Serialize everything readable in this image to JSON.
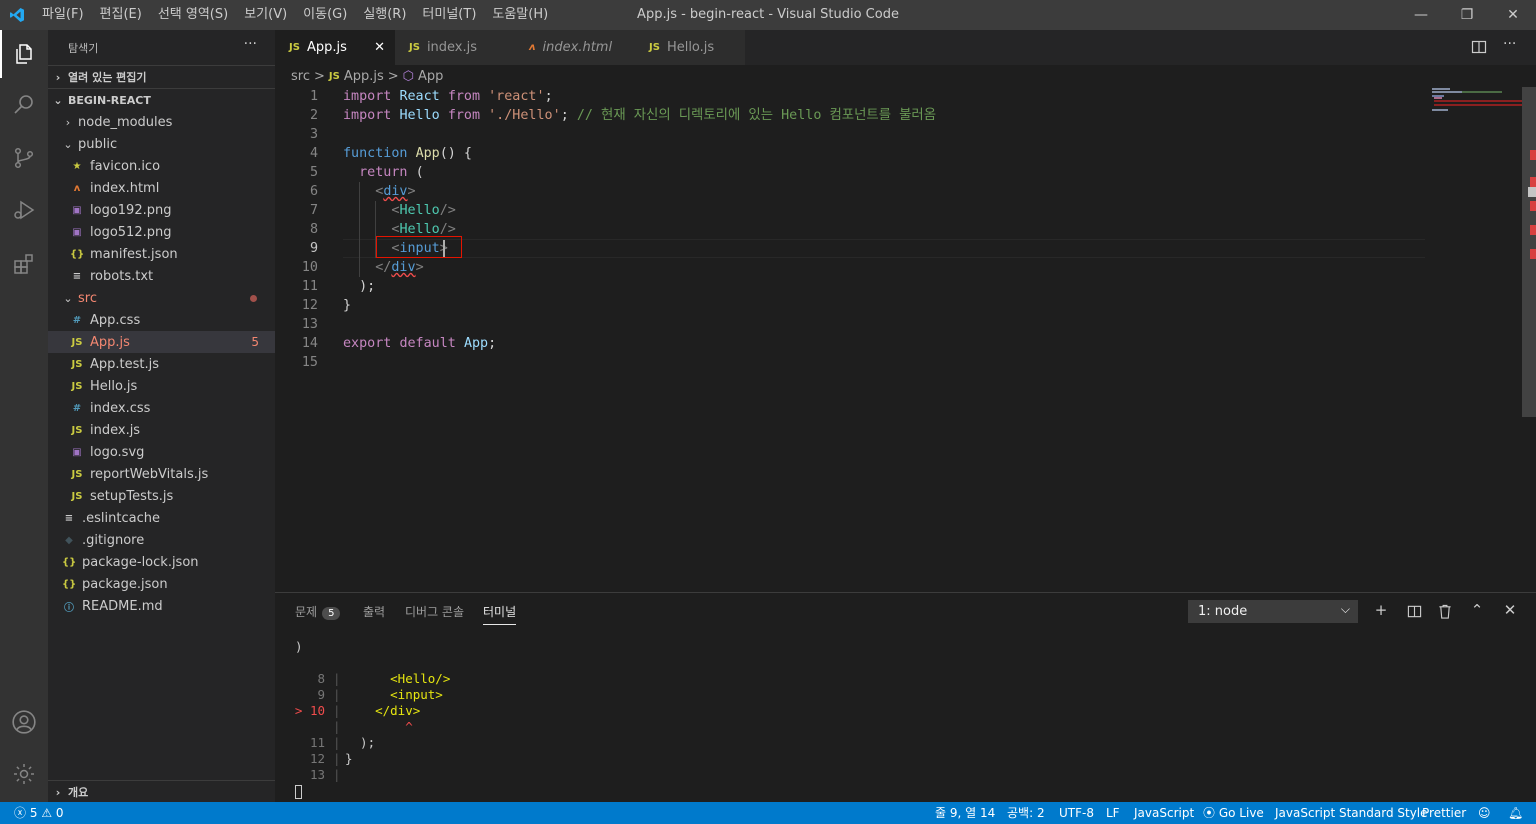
{
  "window": {
    "title": "App.js - begin-react - Visual Studio Code",
    "menu": [
      "파일(F)",
      "편집(E)",
      "선택 영역(S)",
      "보기(V)",
      "이동(G)",
      "실행(R)",
      "터미널(T)",
      "도움말(H)"
    ],
    "controls": {
      "minimize": "—",
      "restore": "❐",
      "close": "✕"
    }
  },
  "activity": [
    "explorer-icon",
    "search-icon",
    "source-control-icon",
    "run-debug-icon",
    "extensions-icon",
    "account-icon",
    "settings-gear-icon"
  ],
  "sidebar": {
    "title": "탐색기",
    "more": "···",
    "open_editors": "열려 있는 편집기",
    "project": "BEGIN-REACT",
    "outline": "개요",
    "tree": [
      {
        "label": "node_modules",
        "type": "folder",
        "expanded": false,
        "indent": 1
      },
      {
        "label": "public",
        "type": "folder",
        "expanded": true,
        "indent": 1
      },
      {
        "label": "favicon.ico",
        "type": "file",
        "icon": "★",
        "color": "#cbcb41",
        "indent": 2
      },
      {
        "label": "index.html",
        "type": "file",
        "icon": "ʌ",
        "color": "#e37933",
        "indent": 2
      },
      {
        "label": "logo192.png",
        "type": "file",
        "icon": "▣",
        "color": "#a074c4",
        "indent": 2
      },
      {
        "label": "logo512.png",
        "type": "file",
        "icon": "▣",
        "color": "#a074c4",
        "indent": 2
      },
      {
        "label": "manifest.json",
        "type": "file",
        "icon": "{}",
        "color": "#cbcb41",
        "indent": 2
      },
      {
        "label": "robots.txt",
        "type": "file",
        "icon": "≡",
        "color": "#cccccc",
        "indent": 2
      },
      {
        "label": "src",
        "type": "folder",
        "expanded": true,
        "indent": 1,
        "color": "#f48771",
        "dot": true
      },
      {
        "label": "App.css",
        "type": "file",
        "icon": "#",
        "color": "#519aba",
        "indent": 2
      },
      {
        "label": "App.js",
        "type": "file",
        "icon": "JS",
        "color": "#cbcb41",
        "indent": 2,
        "selected": true,
        "error": true,
        "count": "5"
      },
      {
        "label": "App.test.js",
        "type": "file",
        "icon": "JS",
        "color": "#cbcb41",
        "indent": 2
      },
      {
        "label": "Hello.js",
        "type": "file",
        "icon": "JS",
        "color": "#cbcb41",
        "indent": 2
      },
      {
        "label": "index.css",
        "type": "file",
        "icon": "#",
        "color": "#519aba",
        "indent": 2
      },
      {
        "label": "index.js",
        "type": "file",
        "icon": "JS",
        "color": "#cbcb41",
        "indent": 2
      },
      {
        "label": "logo.svg",
        "type": "file",
        "icon": "▣",
        "color": "#a074c4",
        "indent": 2
      },
      {
        "label": "reportWebVitals.js",
        "type": "file",
        "icon": "JS",
        "color": "#cbcb41",
        "indent": 2
      },
      {
        "label": "setupTests.js",
        "type": "file",
        "icon": "JS",
        "color": "#cbcb41",
        "indent": 2
      },
      {
        "label": ".eslintcache",
        "type": "file",
        "icon": "≡",
        "color": "#cccccc",
        "indent": 1
      },
      {
        "label": ".gitignore",
        "type": "file",
        "icon": "◆",
        "color": "#41535b",
        "indent": 1
      },
      {
        "label": "package-lock.json",
        "type": "file",
        "icon": "{}",
        "color": "#cbcb41",
        "indent": 1
      },
      {
        "label": "package.json",
        "type": "file",
        "icon": "{}",
        "color": "#cbcb41",
        "indent": 1
      },
      {
        "label": "README.md",
        "type": "file",
        "icon": "ⓘ",
        "color": "#519aba",
        "indent": 1
      }
    ]
  },
  "tabs": [
    {
      "label": "App.js",
      "icon": "JS",
      "active": true,
      "close": "✕"
    },
    {
      "label": "index.js",
      "icon": "JS",
      "active": false
    },
    {
      "label": "index.html",
      "icon": "ʌ",
      "active": false,
      "italic": true
    },
    {
      "label": "Hello.js",
      "icon": "JS",
      "active": false
    }
  ],
  "breadcrumb": [
    "src",
    ">",
    "JS",
    "App.js",
    ">",
    "⬡",
    "App"
  ],
  "editor": {
    "current_line": 9,
    "lines": [
      [
        [
          "kw2",
          "import "
        ],
        [
          "var",
          "React "
        ],
        [
          "kw2",
          "from "
        ],
        [
          "str",
          "'react'"
        ],
        [
          "plain",
          ";"
        ]
      ],
      [
        [
          "kw2",
          "import "
        ],
        [
          "var",
          "Hello "
        ],
        [
          "kw2",
          "from "
        ],
        [
          "str",
          "'./Hello'"
        ],
        [
          "plain",
          "; "
        ],
        [
          "cmt",
          "// 현재 자신의 디렉토리에 있는 Hello 컴포넌트를 불러옴"
        ]
      ],
      [],
      [
        [
          "kw",
          "function "
        ],
        [
          "fn",
          "App"
        ],
        [
          "plain",
          "() {"
        ]
      ],
      [
        [
          "plain",
          "  "
        ],
        [
          "kw2",
          "return "
        ],
        [
          "plain",
          "("
        ]
      ],
      [
        [
          "plain",
          "    "
        ],
        [
          "punc",
          "<"
        ],
        [
          "tag",
          "div"
        ],
        [
          "punc",
          ">"
        ]
      ],
      [
        [
          "plain",
          "      "
        ],
        [
          "punc",
          "<"
        ],
        [
          "cls",
          "Hello"
        ],
        [
          "punc",
          "/>"
        ]
      ],
      [
        [
          "plain",
          "      "
        ],
        [
          "punc",
          "<"
        ],
        [
          "cls",
          "Hello"
        ],
        [
          "punc",
          "/>"
        ]
      ],
      [
        [
          "plain",
          "      "
        ],
        [
          "punc",
          "<"
        ],
        [
          "tag",
          "input"
        ],
        [
          "punc",
          ">"
        ]
      ],
      [
        [
          "plain",
          "    "
        ],
        [
          "punc",
          "</"
        ],
        [
          "tag",
          "div"
        ],
        [
          "punc",
          ">"
        ]
      ],
      [
        [
          "plain",
          "  );"
        ]
      ],
      [
        [
          "plain",
          "}"
        ]
      ],
      [],
      [
        [
          "kw2",
          "export "
        ],
        [
          "kw2",
          "default "
        ],
        [
          "var",
          "App"
        ],
        [
          "plain",
          ";"
        ]
      ],
      []
    ]
  },
  "panel": {
    "tabs": [
      {
        "label": "문제",
        "badge": "5"
      },
      {
        "label": "출력"
      },
      {
        "label": "디버그 콘솔"
      },
      {
        "label": "터미널",
        "active": true
      }
    ],
    "terminal_select": "1: node",
    "terminal_lines": [
      {
        "gutter": "",
        "text": ")"
      },
      {
        "gutter": "",
        "text": ""
      },
      {
        "gutter": "8",
        "text": "      <Hello/>"
      },
      {
        "gutter": "9",
        "text": "      <input>"
      },
      {
        "gutter": "> 10",
        "text": "    </div>",
        "error": true
      },
      {
        "gutter": "",
        "text": "        ^",
        "caret": true
      },
      {
        "gutter": "11",
        "text": "  );"
      },
      {
        "gutter": "12",
        "text": "}"
      },
      {
        "gutter": "13",
        "text": ""
      }
    ]
  },
  "status": {
    "errors": "5",
    "warnings": "0",
    "position": "줄 9, 열 14",
    "spaces": "공백: 2",
    "encoding": "UTF-8",
    "eol": "LF",
    "language": "JavaScript",
    "golive": "Go Live",
    "style": "JavaScript Standard Style",
    "prettier": "Prettier"
  },
  "colors": {
    "accent": "#007acc",
    "error": "#f14c4c",
    "folder_error": "#f48771"
  }
}
